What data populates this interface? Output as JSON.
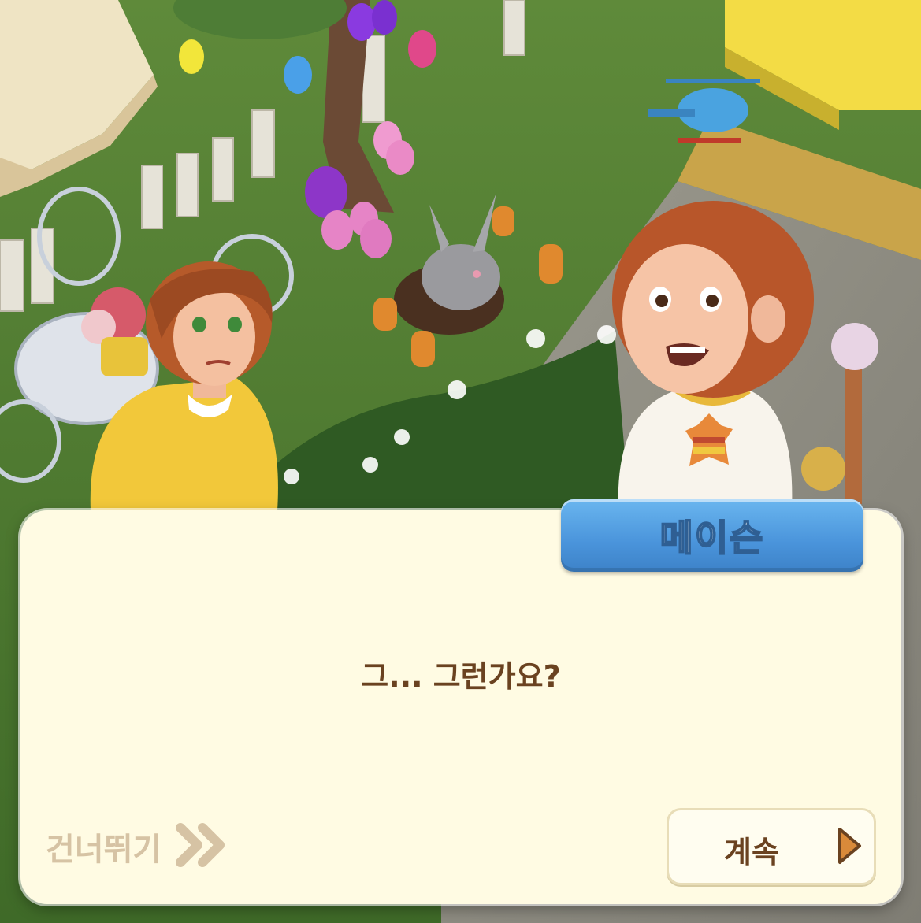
{
  "dialog": {
    "speaker_name": "메이슨",
    "line": "그... 그런가요?",
    "skip_label": "건너뛰기",
    "continue_label": "계속"
  },
  "scene": {
    "characters": [
      "woman-yellow-sweater",
      "curly-haired-boy"
    ],
    "props": [
      "easter-egg-tree",
      "bunny-in-hole",
      "garden-table",
      "toy-helicopter",
      "picket-fence",
      "carrots",
      "flowers"
    ]
  },
  "colors": {
    "dialog_bg": "#fffbe3",
    "name_tag": "#4a94db",
    "text": "#6a4220",
    "skip_text": "#d6c3a4"
  }
}
